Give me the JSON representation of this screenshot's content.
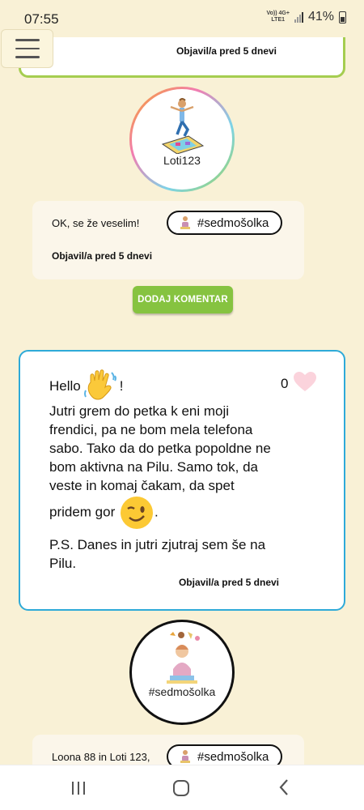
{
  "status_bar": {
    "time": "07:55",
    "network_top": "Vo)) 4G+",
    "network_bottom": "LTE1",
    "battery": "41%"
  },
  "top_card": {
    "posted": "Objavil/a pred 5 dnevi"
  },
  "avatar_1": {
    "name": "Loti123"
  },
  "comment_1": {
    "text": "OK, se že veselim!",
    "tag": "#sedmošolka",
    "posted": "Objavil/a pred 5 dnevi"
  },
  "add_comment_label": "DODAJ KOMENTAR",
  "post": {
    "hello_before": "Hello",
    "hello_after": "!",
    "paragraph_1a": "Jutri grem do petka k eni moji frendici, pa ne bom mela telefona sabo. Tako da do petka popoldne ne bom aktivna na Pilu. Samo tok, da veste in komaj čakam, da spet pridem gor",
    "paragraph_1b": ".",
    "paragraph_2": "P.S. Danes in jutri zjutraj sem še na Pilu.",
    "likes": "0",
    "posted": "Objavil/a pred 5 dnevi",
    "emojis": [
      "waving-hand",
      "winking-face"
    ]
  },
  "avatar_2": {
    "name": "#sedmošolka"
  },
  "comment_2": {
    "text": "Loona 88 in Loti 123,",
    "tag": "#sedmošolka"
  },
  "colors": {
    "background": "#f9f1d6",
    "green": "#86c340",
    "blue_border": "#2eaad8",
    "green_border": "#a5cd50",
    "heart": "#fbd3dc"
  }
}
